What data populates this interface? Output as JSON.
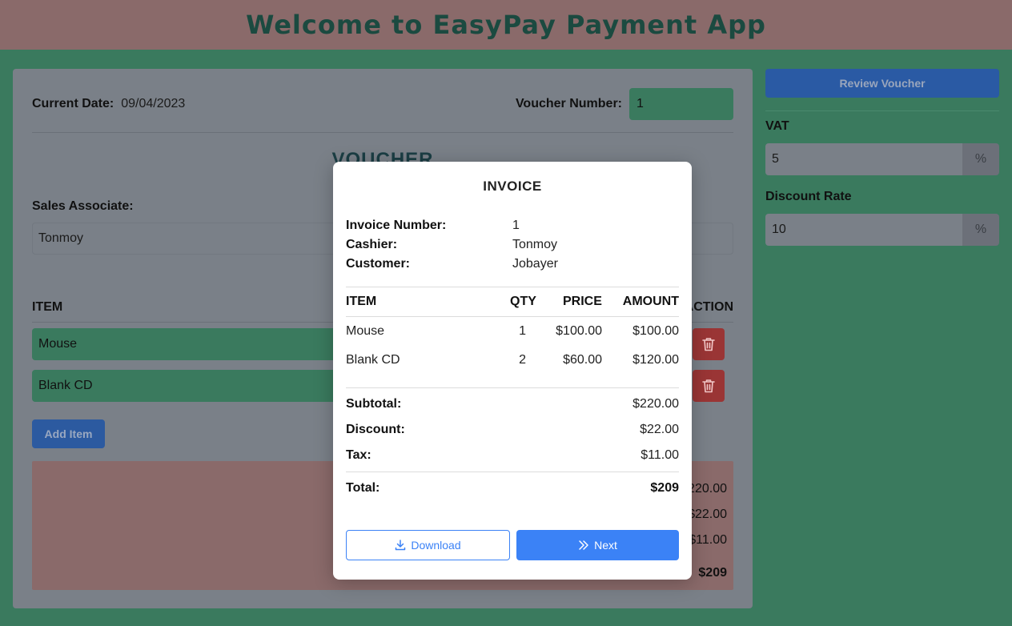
{
  "app": {
    "title": "Welcome to EasyPay Payment App"
  },
  "voucher": {
    "current_date_label": "Current Date:",
    "current_date": "09/04/2023",
    "voucher_number_label": "Voucher Number:",
    "voucher_number": "1",
    "title": "VOUCHER",
    "sales_associate_label": "Sales Associate:",
    "sales_associate": "Tonmoy",
    "item_header": "ITEM",
    "action_header": "ACTION",
    "items": [
      {
        "name": "Mouse"
      },
      {
        "name": "Blank CD"
      }
    ],
    "add_item_label": "Add Item",
    "summary_values": [
      "$220.00",
      "$22.00",
      "$11.00",
      "$209"
    ]
  },
  "sidebar": {
    "review_label": "Review Voucher",
    "vat_label": "VAT",
    "vat_value": "5",
    "discount_label": "Discount Rate",
    "discount_value": "10",
    "percent_symbol": "%"
  },
  "invoice": {
    "title": "INVOICE",
    "number_label": "Invoice Number:",
    "number": "1",
    "cashier_label": "Cashier:",
    "cashier": "Tonmoy",
    "customer_label": "Customer:",
    "customer": "Jobayer",
    "columns": [
      "ITEM",
      "QTY",
      "PRICE",
      "AMOUNT"
    ],
    "rows": [
      {
        "item": "Mouse",
        "qty": "1",
        "price": "$100.00",
        "amount": "$100.00"
      },
      {
        "item": "Blank CD",
        "qty": "2",
        "price": "$60.00",
        "amount": "$120.00"
      }
    ],
    "subtotal_label": "Subtotal:",
    "subtotal": "$220.00",
    "discount_label": "Discount:",
    "discount": "$22.00",
    "tax_label": "Tax:",
    "tax": "$11.00",
    "total_label": "Total:",
    "total": "$209",
    "download_label": "Download",
    "next_label": "Next"
  },
  "colors": {
    "background": "#3a7a5e",
    "header": "#8a6a6a",
    "primary": "#3b82f6",
    "danger": "#9a3535"
  }
}
